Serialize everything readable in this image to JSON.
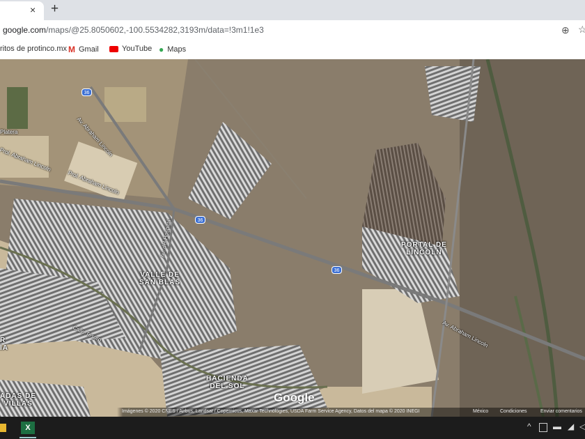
{
  "browser": {
    "tab_close": "×",
    "new_tab": "+",
    "url_host": "google.com",
    "url_path": "/maps/@25.8050602,-100.5534282,3193m/data=!3m1!1e3",
    "bookmarks": [
      {
        "label": "ritos de protinco.mx",
        "icon": "none"
      },
      {
        "label": "Gmail",
        "icon": "gmail-icon"
      },
      {
        "label": "YouTube",
        "icon": "youtube-icon"
      },
      {
        "label": "Maps",
        "icon": "maps-icon"
      }
    ]
  },
  "map": {
    "area_labels": [
      {
        "line1": "VALLE DE",
        "line2": "SAN BLAS"
      },
      {
        "line1": "PORTAL DE",
        "line2": "LINCOLN"
      },
      {
        "line1": "HACIENDA",
        "line2": "DEL SOL"
      },
      {
        "line1": "ADAS DE",
        "line2": "VILLAS"
      },
      {
        "line1": "R",
        "line2": "IA"
      }
    ],
    "place_label": "Platera",
    "roads": [
      "Av. Abraham Lincoln",
      "Prol. Abraham Lincoln",
      "Prol. Abraham Lincoln",
      "Av. del Hospital",
      "Calle Tesoro",
      "Av. Abraham Lincoln"
    ],
    "highway": "36",
    "logo": "Google",
    "attribution": "Imágenes © 2020 CNES / Airbus, Landsat / Copernicus, Maxar Technologies, USDA Farm Service Agency, Datos del mapa © 2020 INEGI",
    "links": [
      "México",
      "Condiciones",
      "Enviar comentarios"
    ]
  },
  "taskbar": {
    "tray_chevron": "^"
  }
}
